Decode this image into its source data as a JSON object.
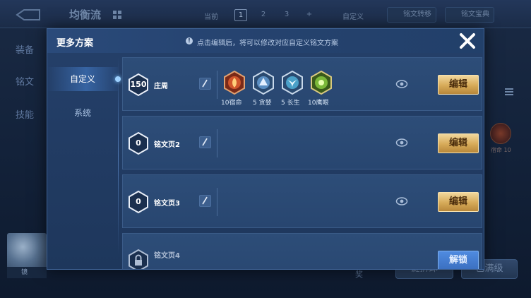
{
  "background": {
    "title": "均衡流",
    "current_label": "当前",
    "pages": [
      "1",
      "2",
      "3",
      "+"
    ],
    "custom_label": "自定义",
    "rune_transfer_label": "铭文转移",
    "rune_guide_label": "铭文宝典",
    "sidebar": [
      "装备",
      "铭文",
      "技能"
    ],
    "hero_name": "镜",
    "rune_name": "宿命",
    "rune_level": "10",
    "footer_text": "奖",
    "button_left": "键拆卸",
    "button_right": "已满级"
  },
  "modal": {
    "title": "更多方案",
    "hint_icon": "!",
    "hint": "点击编辑后，将可以修改对应自定义铭文方案",
    "close_icon": "close-icon",
    "tabs": [
      {
        "label": "自定义",
        "active": true
      },
      {
        "label": "系统",
        "active": false
      }
    ],
    "rows": [
      {
        "level": "150",
        "name": "庄周",
        "action": "编辑",
        "runes": [
          {
            "icon": "red-rune-icon",
            "label": "10宿命",
            "color": "#d0562c"
          },
          {
            "icon": "blue-rune-icon",
            "label": "5 贪婪",
            "color": "#5a8ec2"
          },
          {
            "icon": "blue-rune-icon",
            "label": "5 长生",
            "color": "#4aa0c8"
          },
          {
            "icon": "green-rune-icon",
            "label": "10鹰眼",
            "color": "#7bb83a"
          }
        ]
      },
      {
        "level": "0",
        "name": "铭文页2",
        "action": "编辑",
        "runes": []
      },
      {
        "level": "0",
        "name": "铭文页3",
        "action": "编辑",
        "runes": []
      },
      {
        "level": "",
        "name": "铭文页4",
        "action": "解锁",
        "runes": []
      }
    ]
  },
  "colors": {
    "accent_gold": "#d6aa58",
    "panel_blue": "#2d4d78",
    "unlock_blue": "#3b6fc0"
  }
}
